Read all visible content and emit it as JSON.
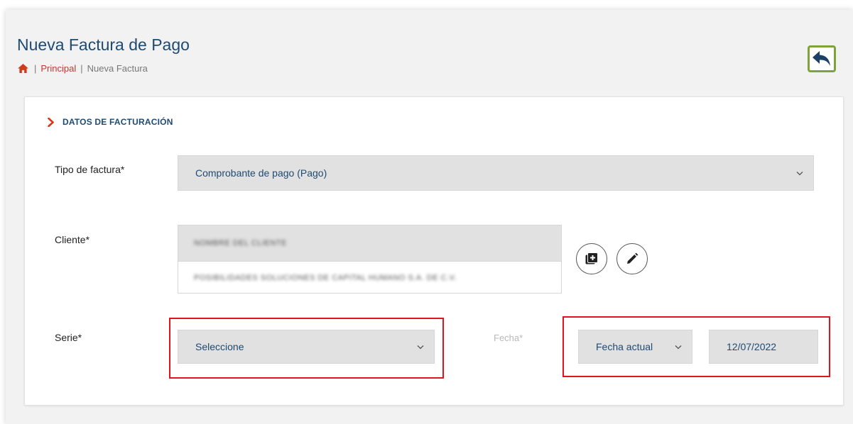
{
  "header": {
    "title": "Nueva Factura de Pago",
    "breadcrumb": {
      "separator": "|",
      "home_link": "Principal",
      "current": "Nueva Factura"
    },
    "back_icon": "reply-arrow-icon"
  },
  "section": {
    "title": "DATOS DE FACTURACIÓN"
  },
  "form": {
    "tipo_factura": {
      "label": "Tipo de factura*",
      "value": "Comprobante de pago (Pago)"
    },
    "cliente": {
      "label": "Cliente*",
      "name": "NOMBRE DEL CLIENTE",
      "company": "POSIBILIDADES SOLUCIONES DE CAPITAL HUMANO S.A. DE C.V.",
      "add_icon": "add-library-icon",
      "edit_icon": "pencil-icon"
    },
    "serie": {
      "label": "Serie*",
      "value": "Seleccione"
    },
    "fecha": {
      "label": "Fecha*",
      "mode": "Fecha actual",
      "date": "12/07/2022"
    }
  },
  "colors": {
    "title": "#1e4a73",
    "accent_red": "#c0392b",
    "back_border": "#7ea33a",
    "highlight": "#e0141e"
  }
}
